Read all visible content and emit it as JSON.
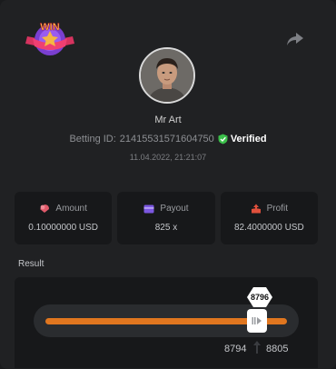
{
  "badge": {
    "text": "WIN"
  },
  "user": {
    "name": "Mr Art"
  },
  "bet": {
    "id_label": "Betting ID:",
    "id_value": "21415531571604750",
    "verified_label": "Verified",
    "timestamp": "11.04.2022, 21:21:07"
  },
  "stats": {
    "amount": {
      "label": "Amount",
      "value": "0.10000000 USD",
      "icon": "coins-icon"
    },
    "payout": {
      "label": "Payout",
      "value": "825 x",
      "icon": "card-icon"
    },
    "profit": {
      "label": "Profit",
      "value": "82.4000000 USD",
      "icon": "profit-icon"
    }
  },
  "result": {
    "label": "Result",
    "value": "8796",
    "range_min": "8794",
    "range_max": "8805"
  },
  "colors": {
    "accent": "#e0761f",
    "verified": "#3bbf4a",
    "amount_icon": "#e05a6a",
    "payout_icon": "#7b57e0",
    "profit_icon": "#e0503c"
  }
}
